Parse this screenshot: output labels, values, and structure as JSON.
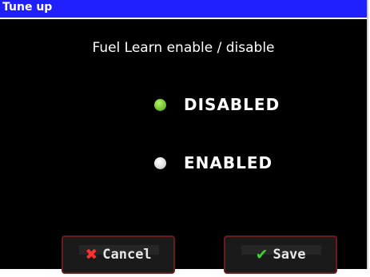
{
  "window": {
    "title": "Tune up"
  },
  "heading": "Fuel Learn enable / disable",
  "options": [
    {
      "label": "DISABLED",
      "selected": true
    },
    {
      "label": "ENABLED",
      "selected": false
    }
  ],
  "buttons": {
    "cancel": {
      "label": "Cancel",
      "icon": "x-icon",
      "icon_glyph": "✖",
      "icon_color": "#ff3030"
    },
    "save": {
      "label": "Save",
      "icon": "checkmark-icon",
      "icon_glyph": "✔",
      "icon_color": "#3cd030"
    }
  },
  "colors": {
    "titlebar": "#2020ff",
    "background": "#000000",
    "selected_radio": "#6cc02a",
    "unselected_radio": "#d8d8d8",
    "button_border": "#6a1c1c"
  }
}
